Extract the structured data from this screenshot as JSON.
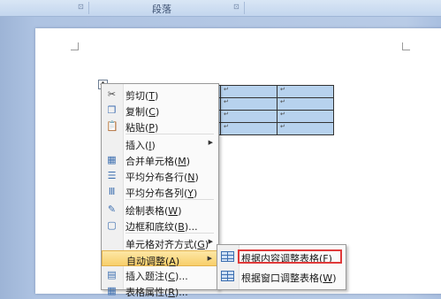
{
  "ribbon": {
    "group_label": "段落"
  },
  "table": {
    "rows": [
      [
        "↵",
        "↵",
        "↵",
        "↵"
      ],
      [
        "↵",
        "↵",
        "↵",
        "↵"
      ],
      [
        "↵",
        "↵",
        "↵",
        "↵"
      ],
      [
        "↵",
        "↵",
        "↵",
        "↵"
      ]
    ],
    "handle_icon": "move-handle-icon"
  },
  "context_menu": {
    "items": [
      {
        "label": "剪切(",
        "key": "T",
        "end": ")",
        "icon": "scissors-icon"
      },
      {
        "label": "复制(",
        "key": "C",
        "end": ")",
        "icon": "copy-icon"
      },
      {
        "label": "粘贴(",
        "key": "P",
        "end": ")",
        "icon": "paste-icon"
      },
      {
        "label": "插入(",
        "key": "I",
        "end": ")",
        "icon": "",
        "submenu": true
      },
      {
        "label": "合并单元格(",
        "key": "M",
        "end": ")",
        "icon": "merge-cells-icon"
      },
      {
        "label": "平均分布各行(",
        "key": "N",
        "end": ")",
        "icon": "distribute-rows-icon"
      },
      {
        "label": "平均分布各列(",
        "key": "Y",
        "end": ")",
        "icon": "distribute-columns-icon"
      },
      {
        "label": "绘制表格(",
        "key": "W",
        "end": ")",
        "icon": "draw-table-icon"
      },
      {
        "label": "边框和底纹(",
        "key": "B",
        "end": ")...",
        "icon": "borders-shading-icon"
      },
      {
        "label": "单元格对齐方式(",
        "key": "G",
        "end": ")",
        "icon": "",
        "submenu": true
      },
      {
        "label": "自动调整(",
        "key": "A",
        "end": ")",
        "icon": "",
        "submenu": true,
        "highlighted": true
      },
      {
        "label": "插入题注(",
        "key": "C",
        "end": ")...",
        "icon": "insert-caption-icon"
      },
      {
        "label": "表格属性(",
        "key": "R",
        "end": ")...",
        "icon": "table-properties-icon"
      }
    ]
  },
  "autofit_submenu": {
    "items": [
      {
        "label": "根据内容调整表格(",
        "key": "F",
        "end": ")",
        "icon": "autofit-contents-icon",
        "focused": true
      },
      {
        "label": "根据窗口调整表格(",
        "key": "W",
        "end": ")",
        "icon": "autofit-window-icon"
      }
    ]
  },
  "colors": {
    "highlight": "#f8cf6a",
    "focus_box": "#e03a3a",
    "table_fill": "#b7d2ee"
  }
}
